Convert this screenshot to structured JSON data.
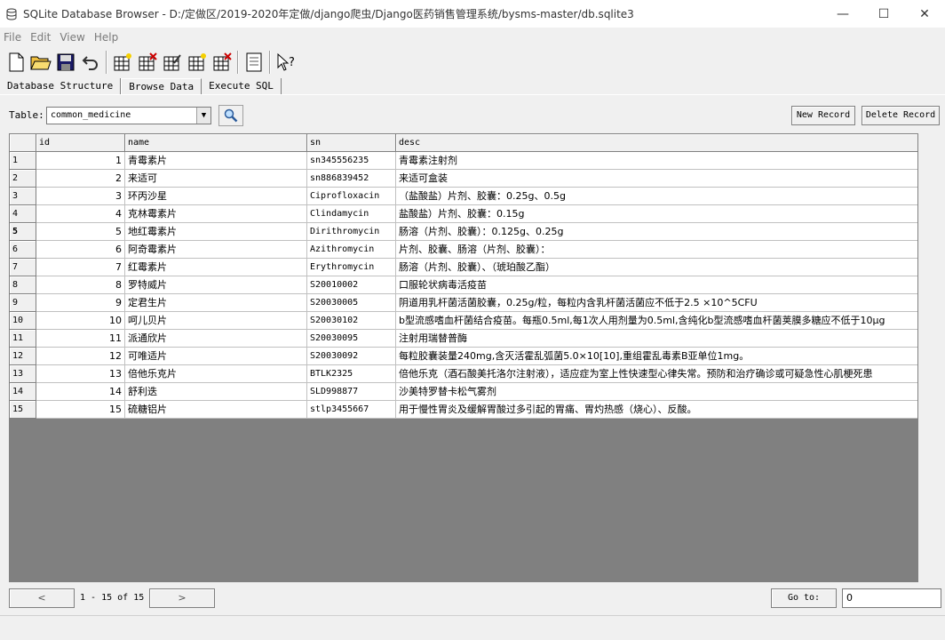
{
  "window": {
    "title": "SQLite Database Browser - D:/定做区/2019-2020年定做/django爬虫/Django医药销售管理系统/bysms-master/db.sqlite3",
    "min": "—",
    "max": "☐",
    "close": "✕"
  },
  "menu": [
    "File",
    "Edit",
    "View",
    "Help"
  ],
  "tabs": [
    "Database Structure",
    "Browse Data",
    "Execute SQL"
  ],
  "table_select": {
    "label": "Table:",
    "value": "common_medicine"
  },
  "buttons": {
    "new_record": "New Record",
    "delete_record": "Delete Record"
  },
  "grid": {
    "columns": [
      "id",
      "name",
      "sn",
      "desc"
    ],
    "rows": [
      {
        "num": "1",
        "id": "1",
        "name": "青霉素片",
        "sn": "sn345556235",
        "desc": "青霉素注射剂"
      },
      {
        "num": "2",
        "id": "2",
        "name": "来适可",
        "sn": "sn886839452",
        "desc": "来适可盒装"
      },
      {
        "num": "3",
        "id": "3",
        "name": "环丙沙星",
        "sn": "Ciprofloxacin",
        "desc": "（盐酸盐）片剂、胶囊：0.25g、0.5g"
      },
      {
        "num": "4",
        "id": "4",
        "name": "克林霉素片",
        "sn": "Clindamycin",
        "desc": "盐酸盐）片剂、胶囊：0.15g"
      },
      {
        "num": "5",
        "id": "5",
        "name": "地红霉素片",
        "sn": "Dirithromycin",
        "desc": "肠溶（片剂、胶囊）：0.125g、0.25g"
      },
      {
        "num": "6",
        "id": "6",
        "name": "阿奇霉素片",
        "sn": "Azithromycin",
        "desc": "片剂、胶囊、肠溶（片剂、胶囊）："
      },
      {
        "num": "7",
        "id": "7",
        "name": "红霉素片",
        "sn": "Erythromycin",
        "desc": "肠溶（片剂、胶囊）、（琥珀酸乙酯）"
      },
      {
        "num": "8",
        "id": "8",
        "name": "罗特威片",
        "sn": "S20010002",
        "desc": "口服轮状病毒活疫苗"
      },
      {
        "num": "9",
        "id": "9",
        "name": "定君生片",
        "sn": "S20030005",
        "desc": "阴道用乳杆菌活菌胶囊，0.25g/粒，每粒内含乳杆菌活菌应不低于2.5 ×10^5CFU"
      },
      {
        "num": "10",
        "id": "10",
        "name": "呵儿贝片",
        "sn": "S20030102",
        "desc": "b型流感嗜血杆菌结合疫苗。每瓶0.5ml,每1次人用剂量为0.5ml,含纯化b型流感嗜血杆菌荚膜多糖应不低于10μg"
      },
      {
        "num": "11",
        "id": "11",
        "name": "派通欣片",
        "sn": "S20030095",
        "desc": "注射用瑞替普酶"
      },
      {
        "num": "12",
        "id": "12",
        "name": "可唯适片",
        "sn": "S20030092",
        "desc": "每粒胶囊装量240mg,含灭活霍乱弧菌5.0×10[10],重组霍乱毒素B亚单位1mg。"
      },
      {
        "num": "13",
        "id": "13",
        "name": "倍他乐克片",
        "sn": "BTLK2325",
        "desc": "倍他乐克（酒石酸美托洛尔注射液），适应症为室上性快速型心律失常。预防和治疗确诊或可疑急性心肌梗死患"
      },
      {
        "num": "14",
        "id": "14",
        "name": "舒利迭",
        "sn": "SLD998877",
        "desc": "沙美特罗替卡松气雾剂"
      },
      {
        "num": "15",
        "id": "15",
        "name": "硫糖铝片",
        "sn": "stlp3455667",
        "desc": "用于慢性胃炎及缓解胃酸过多引起的胃痛、胃灼热感（烧心）、反酸。"
      }
    ]
  },
  "status": {
    "prev": "<",
    "range": "1 - 15 of 15",
    "next": ">",
    "goto_label": "Go to:",
    "goto_value": "0"
  }
}
